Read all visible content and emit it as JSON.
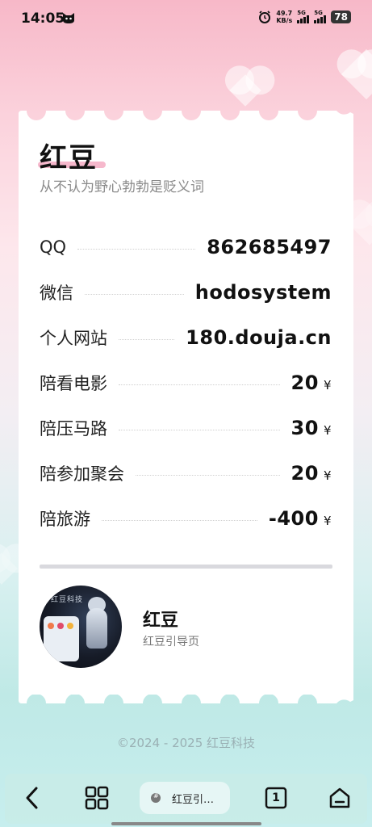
{
  "status_bar": {
    "time": "14:05",
    "net_speed_value": "49.7",
    "net_speed_unit": "KB/s",
    "sim1_label": "5G",
    "sim2_label": "5G",
    "battery": "78"
  },
  "card": {
    "title": "红豆",
    "subtitle": "从不认为野心勃勃是贬义词",
    "rows": [
      {
        "label": "QQ",
        "value": "862685497",
        "unit": ""
      },
      {
        "label": "微信",
        "value": "hodosystem",
        "unit": ""
      },
      {
        "label": "个人网站",
        "value": "180.douja.cn",
        "unit": ""
      },
      {
        "label": "陪看电影",
        "value": "20",
        "unit": "¥"
      },
      {
        "label": "陪压马路",
        "value": "30",
        "unit": "¥"
      },
      {
        "label": "陪参加聚会",
        "value": "20",
        "unit": "¥"
      },
      {
        "label": "陪旅游",
        "value": "-400",
        "unit": "¥"
      }
    ],
    "profile": {
      "avatar_caption": "红豆科技",
      "name": "红豆",
      "description": "红豆引导页"
    }
  },
  "footer": {
    "copyright": "©2024 - 2025 红豆科技"
  },
  "bottom_nav": {
    "tab_label": "红豆引…",
    "tab_count": "1",
    "icons": [
      "back-icon",
      "apps-grid-icon",
      "tabs-icon",
      "home-icon"
    ]
  },
  "colors": {
    "accent_pink": "#f4a6bf",
    "nav_bg": "#c8ece8"
  }
}
